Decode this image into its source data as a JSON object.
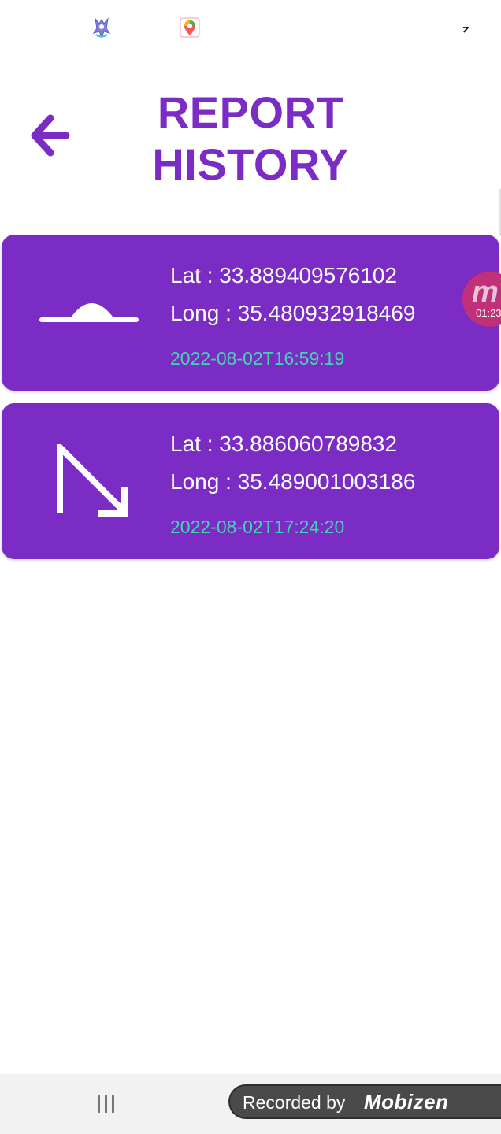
{
  "header": {
    "title_line1": "REPORT",
    "title_line2": "HISTORY"
  },
  "status_bar": {
    "icons": [
      "app-icon",
      "map-pin-icon",
      "signal-icon"
    ]
  },
  "reports": [
    {
      "icon": "speed-bump-icon",
      "lat": "Lat : 33.889409576102",
      "long": "Long : 35.480932918469",
      "date": "2022-08-02T16:59:19"
    },
    {
      "icon": "arrow-down-right-icon",
      "lat": "Lat : 33.886060789832",
      "long": "Long : 35.489001003186",
      "date": "2022-08-02T17:24:20"
    }
  ],
  "recorder": {
    "bubble_letter": "m",
    "bubble_time": "01:23",
    "banner_text": "Recorded by",
    "banner_logo": "Mobizen"
  },
  "colors": {
    "accent": "#7a2cc4",
    "date_text": "#42d6ae",
    "card_text": "#ffffff",
    "recorder_bubble": "#c0317a"
  }
}
